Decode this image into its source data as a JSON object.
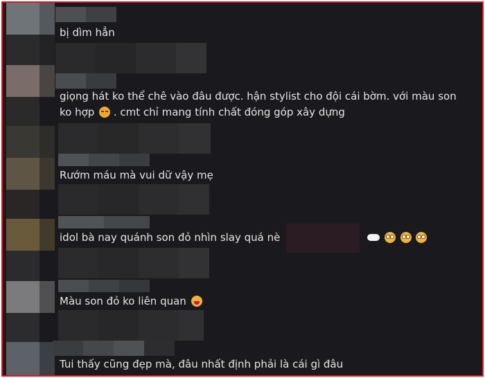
{
  "comments": [
    {
      "text": "bị dìm hẳn"
    },
    {
      "line1": "giọng hát ko thể chê vào đâu được. hận stylist cho đội cái bờm. với màu son",
      "line2": "ko hợp",
      "line3": ". cmt chỉ mang tính chất đóng góp xây dựng",
      "emoji": "pensive-face-icon"
    },
    {
      "text": "Rướm máu mà vui dữ vậy mẹ"
    },
    {
      "text": "idol bà nay quánh son đỏ nhìn slay quá nè",
      "emojis": [
        "cloud-icon",
        "flushed-face-icon",
        "flushed-face-icon",
        "flushed-face-icon"
      ]
    },
    {
      "text": "Màu son đỏ ko liên quan",
      "emoji": "laughing-tears-icon"
    },
    {
      "text": "Tui thấy cũng đẹp mà, đâu nhất định phải là cái gì đâu"
    }
  ],
  "colors": {
    "border": "#e0141e",
    "background": "#1a1a1e",
    "text": "#e6e6e6"
  }
}
